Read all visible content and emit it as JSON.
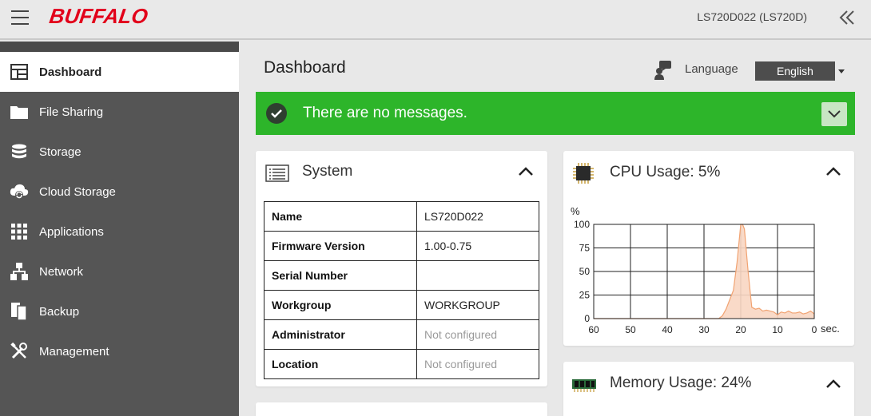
{
  "header": {
    "logo": "BUFFALO",
    "device_name": "LS720D022 (LS720D)"
  },
  "sidebar": {
    "items": [
      {
        "label": "Dashboard",
        "icon": "dashboard-icon",
        "active": true
      },
      {
        "label": "File Sharing",
        "icon": "folder-icon"
      },
      {
        "label": "Storage",
        "icon": "database-icon"
      },
      {
        "label": "Cloud Storage",
        "icon": "cloud-sync-icon"
      },
      {
        "label": "Applications",
        "icon": "apps-grid-icon"
      },
      {
        "label": "Network",
        "icon": "network-icon"
      },
      {
        "label": "Backup",
        "icon": "backup-icon"
      },
      {
        "label": "Management",
        "icon": "tools-icon"
      }
    ]
  },
  "main": {
    "title": "Dashboard",
    "language_label": "Language",
    "language_value": "English",
    "message": "There are no messages.",
    "colors": {
      "accent_green": "#2db52a",
      "brand_red": "#e2001a",
      "sidebar": "#555555"
    }
  },
  "system": {
    "title": "System",
    "rows": [
      {
        "key": "Name",
        "value": "LS720D022",
        "muted": false
      },
      {
        "key": "Firmware Version",
        "value": "1.00-0.75",
        "muted": false
      },
      {
        "key": "Serial Number",
        "value": "",
        "muted": false
      },
      {
        "key": "Workgroup",
        "value": "WORKGROUP",
        "muted": false
      },
      {
        "key": "Administrator",
        "value": "Not configured",
        "muted": true
      },
      {
        "key": "Location",
        "value": "Not configured",
        "muted": true
      }
    ]
  },
  "cpu": {
    "title": "CPU Usage: 5%",
    "unit_label": "%",
    "x_unit": "sec."
  },
  "memory": {
    "title": "Memory Usage: 24%"
  },
  "chart_data": {
    "type": "area",
    "x": [
      60,
      55,
      50,
      45,
      40,
      35,
      30,
      26,
      25,
      24,
      23,
      22,
      21,
      20,
      19.5,
      19,
      18,
      17,
      16,
      15,
      14,
      13,
      12,
      11,
      10,
      9,
      8,
      7,
      6,
      5,
      4,
      3,
      2,
      1,
      0
    ],
    "values": [
      0,
      0,
      0,
      0,
      0,
      0,
      0,
      0,
      3,
      10,
      20,
      30,
      60,
      100,
      100,
      95,
      50,
      12,
      10,
      11,
      8,
      9,
      8,
      7,
      4,
      7,
      6,
      8,
      6,
      6,
      7,
      5,
      6,
      8,
      5
    ],
    "xlim": [
      60,
      0
    ],
    "ylim": [
      0,
      100
    ],
    "xticks": [
      "60",
      "50",
      "40",
      "30",
      "20",
      "10",
      "0"
    ],
    "yticks": [
      "100",
      "75",
      "50",
      "25",
      "0"
    ],
    "ylabel": "%",
    "xlabel": "sec.",
    "grid": true
  }
}
